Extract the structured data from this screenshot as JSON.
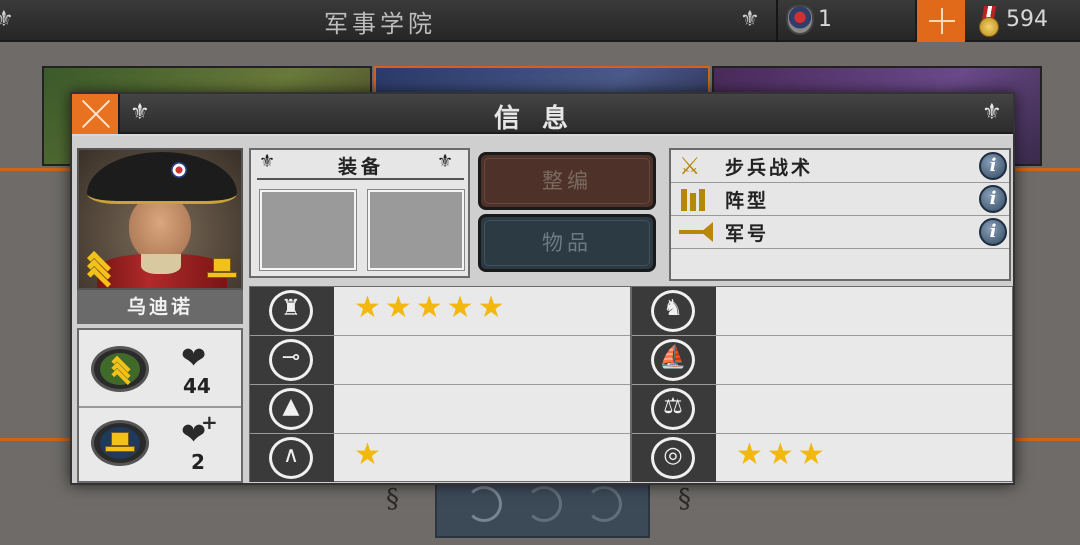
{
  "topbar": {
    "title": "军事学院",
    "shield_count": "1",
    "medal_count": "594"
  },
  "dialog": {
    "title": "信息",
    "officer": {
      "name": "乌迪诺",
      "health": "44",
      "health_bonus": "2"
    },
    "equipment": {
      "title": "装备",
      "slots": [
        "",
        ""
      ]
    },
    "buttons": {
      "reorganize": "整编",
      "items": "物品"
    },
    "skills": [
      {
        "label": "步兵战术",
        "icon": "crossed-swords-icon"
      },
      {
        "label": "阵型",
        "icon": "formation-icon"
      },
      {
        "label": "军号",
        "icon": "bugle-icon"
      }
    ],
    "attributes_left": [
      {
        "icon": "infantry-icon",
        "stars": "★★★★★",
        "rating": 5
      },
      {
        "icon": "cannon-icon",
        "stars": "",
        "rating": 0
      },
      {
        "icon": "fortification-icon",
        "stars": "",
        "rating": 0
      },
      {
        "icon": "march-icon",
        "stars": "★",
        "rating": 1
      }
    ],
    "attributes_right": [
      {
        "icon": "cavalry-icon",
        "stars": "",
        "rating": 0
      },
      {
        "icon": "ship-icon",
        "stars": "",
        "rating": 0
      },
      {
        "icon": "balance-icon",
        "stars": "",
        "rating": 0
      },
      {
        "icon": "target-icon",
        "stars": "★★★",
        "rating": 3
      }
    ]
  },
  "colors": {
    "accent_orange": "#e8721f",
    "star_gold": "#f2b80f",
    "rank_gold": "#f2c21a"
  }
}
